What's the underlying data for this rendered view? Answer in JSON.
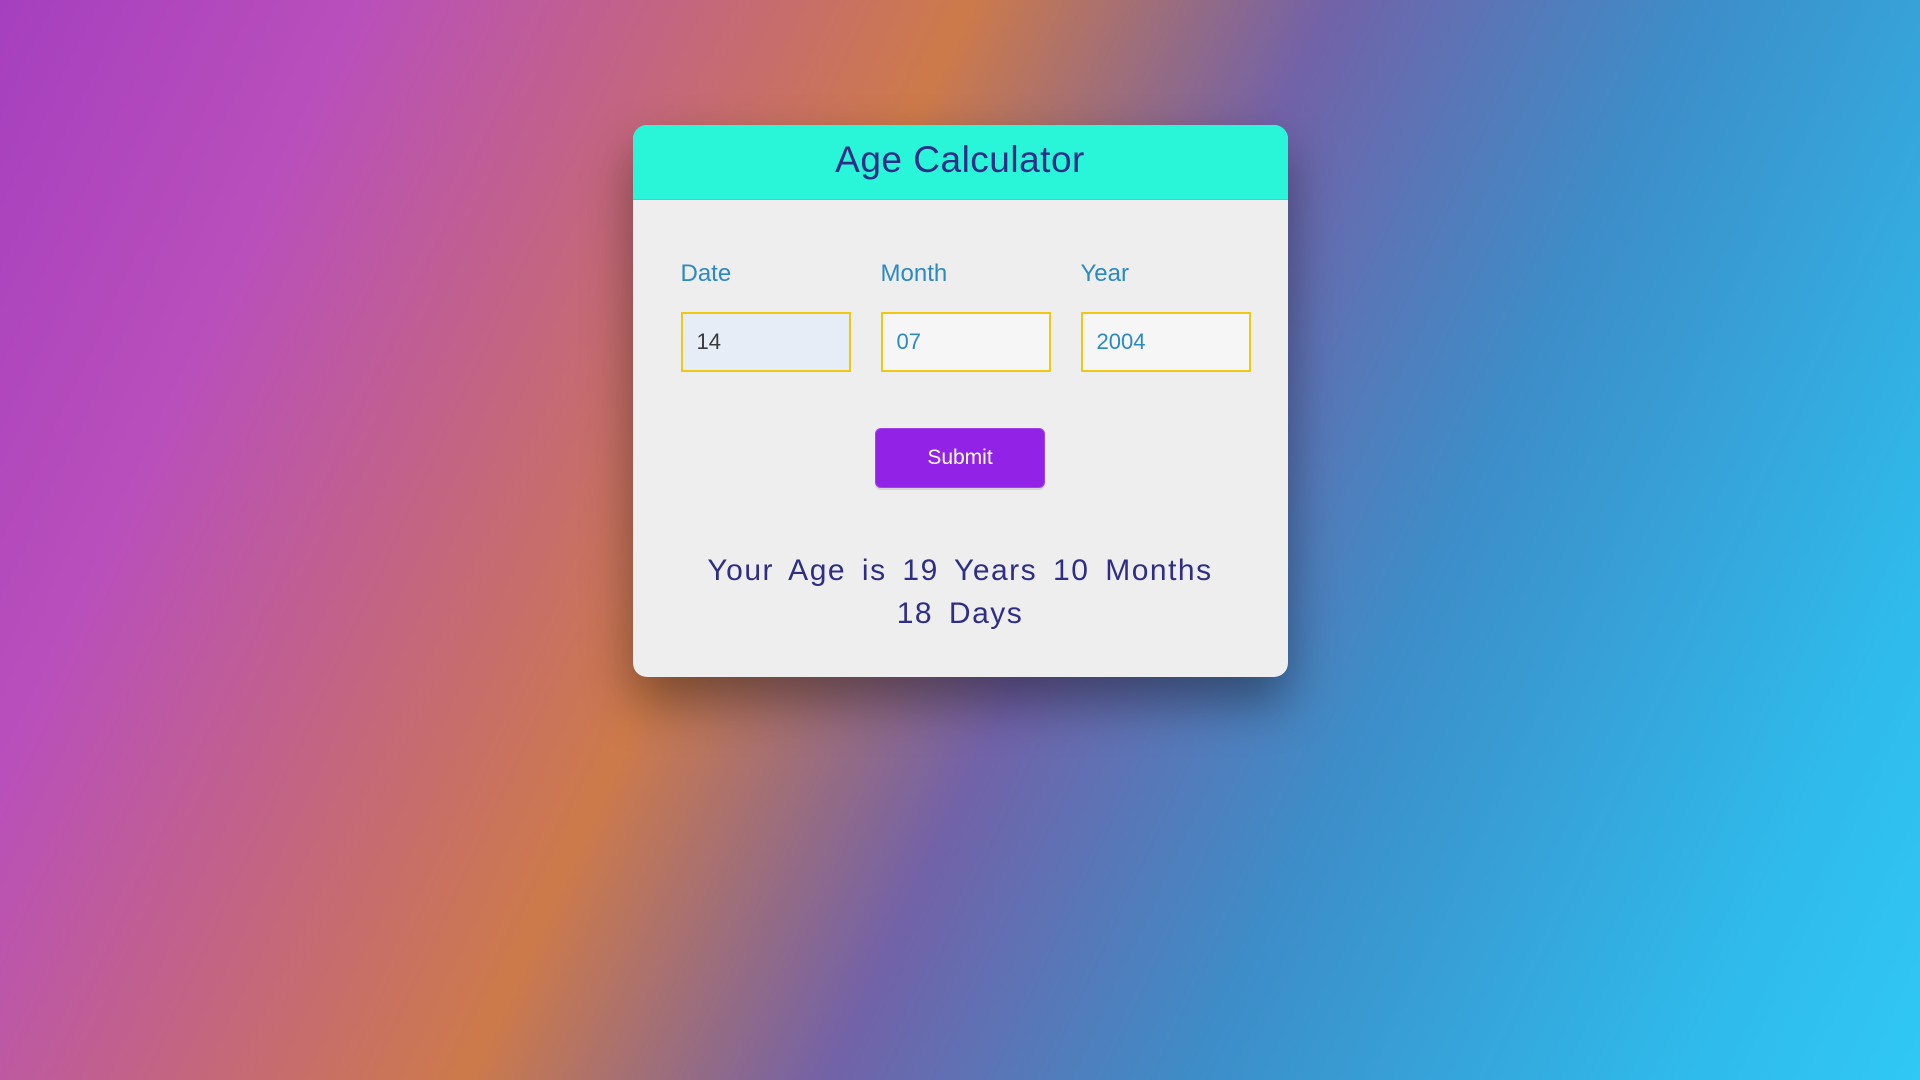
{
  "header": {
    "title": "Age Calculator"
  },
  "form": {
    "date": {
      "label": "Date",
      "value": "14"
    },
    "month": {
      "label": "Month",
      "placeholder": "07",
      "value": ""
    },
    "year": {
      "label": "Year",
      "placeholder": "2004",
      "value": ""
    },
    "submit_label": "Submit"
  },
  "result": {
    "text": "Your Age is 19 Years 10 Months 18 Days"
  }
}
